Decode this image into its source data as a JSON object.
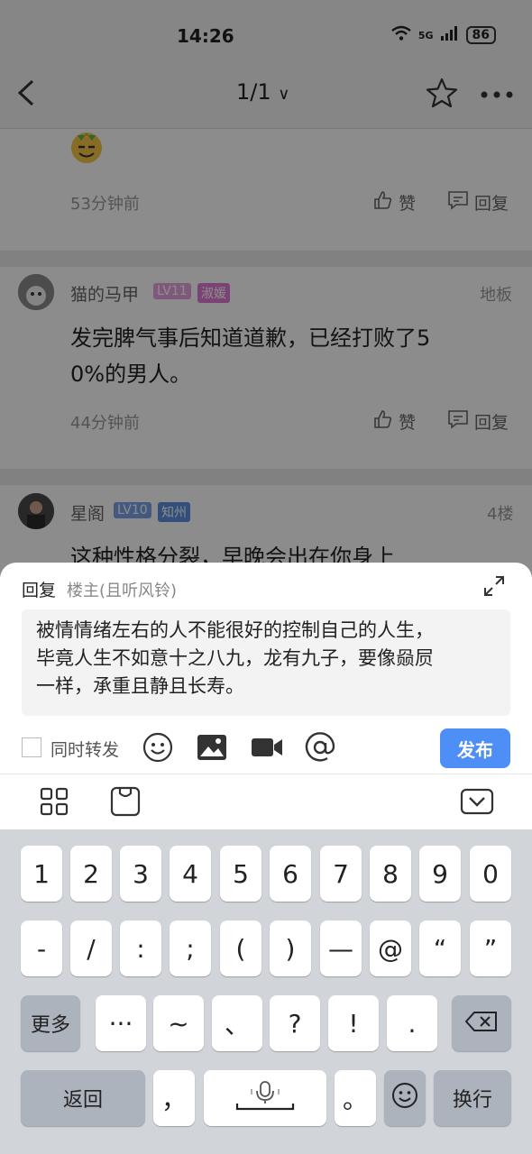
{
  "status": {
    "time": "14:26",
    "network": "5G",
    "battery": "86"
  },
  "nav": {
    "title": "1/1"
  },
  "comments": [
    {
      "time": "53分钟前",
      "like": "赞",
      "reply": "回复"
    },
    {
      "username": "猫的马甲",
      "level": "LV11",
      "tag": "淑媛",
      "floor": "地板",
      "text_line1": "发完脾气事后知道道歉，已经打败了5",
      "text_line2": "0%的男人。",
      "time": "44分钟前",
      "like": "赞",
      "reply": "回复"
    },
    {
      "username": "星阁",
      "level": "LV10",
      "tag": "知州",
      "floor": "4楼",
      "text_line1": "这种性格分裂，早晚会出在你身上"
    }
  ],
  "reply_panel": {
    "label": "回复",
    "target": "楼主(且听风铃)",
    "text_line1": "被情情绪左右的人不能很好的控制自己的人生，",
    "text_line2": "毕竟人生不如意十之八九，龙有九子，要像赑屃",
    "text_line3": "一样，承重且静且长寿。",
    "repost_label": "同时转发",
    "publish_label": "发布"
  },
  "keyboard": {
    "row1": [
      "1",
      "2",
      "3",
      "4",
      "5",
      "6",
      "7",
      "8",
      "9",
      "0"
    ],
    "row2": [
      "-",
      "/",
      ":",
      ";",
      "(",
      ")",
      "—",
      "@",
      "“",
      "”"
    ],
    "row3": [
      "更多",
      "···",
      "~",
      "、",
      "?",
      "!",
      "."
    ],
    "row4": {
      "back": "返回",
      "comma": "，",
      "period": "。",
      "newline": "换行"
    }
  },
  "colors": {
    "accent": "#4e8ef7",
    "level_badge": "#e7a3e0",
    "tag_badge": "#e07ad6",
    "level_badge2": "#7ca2e8"
  }
}
